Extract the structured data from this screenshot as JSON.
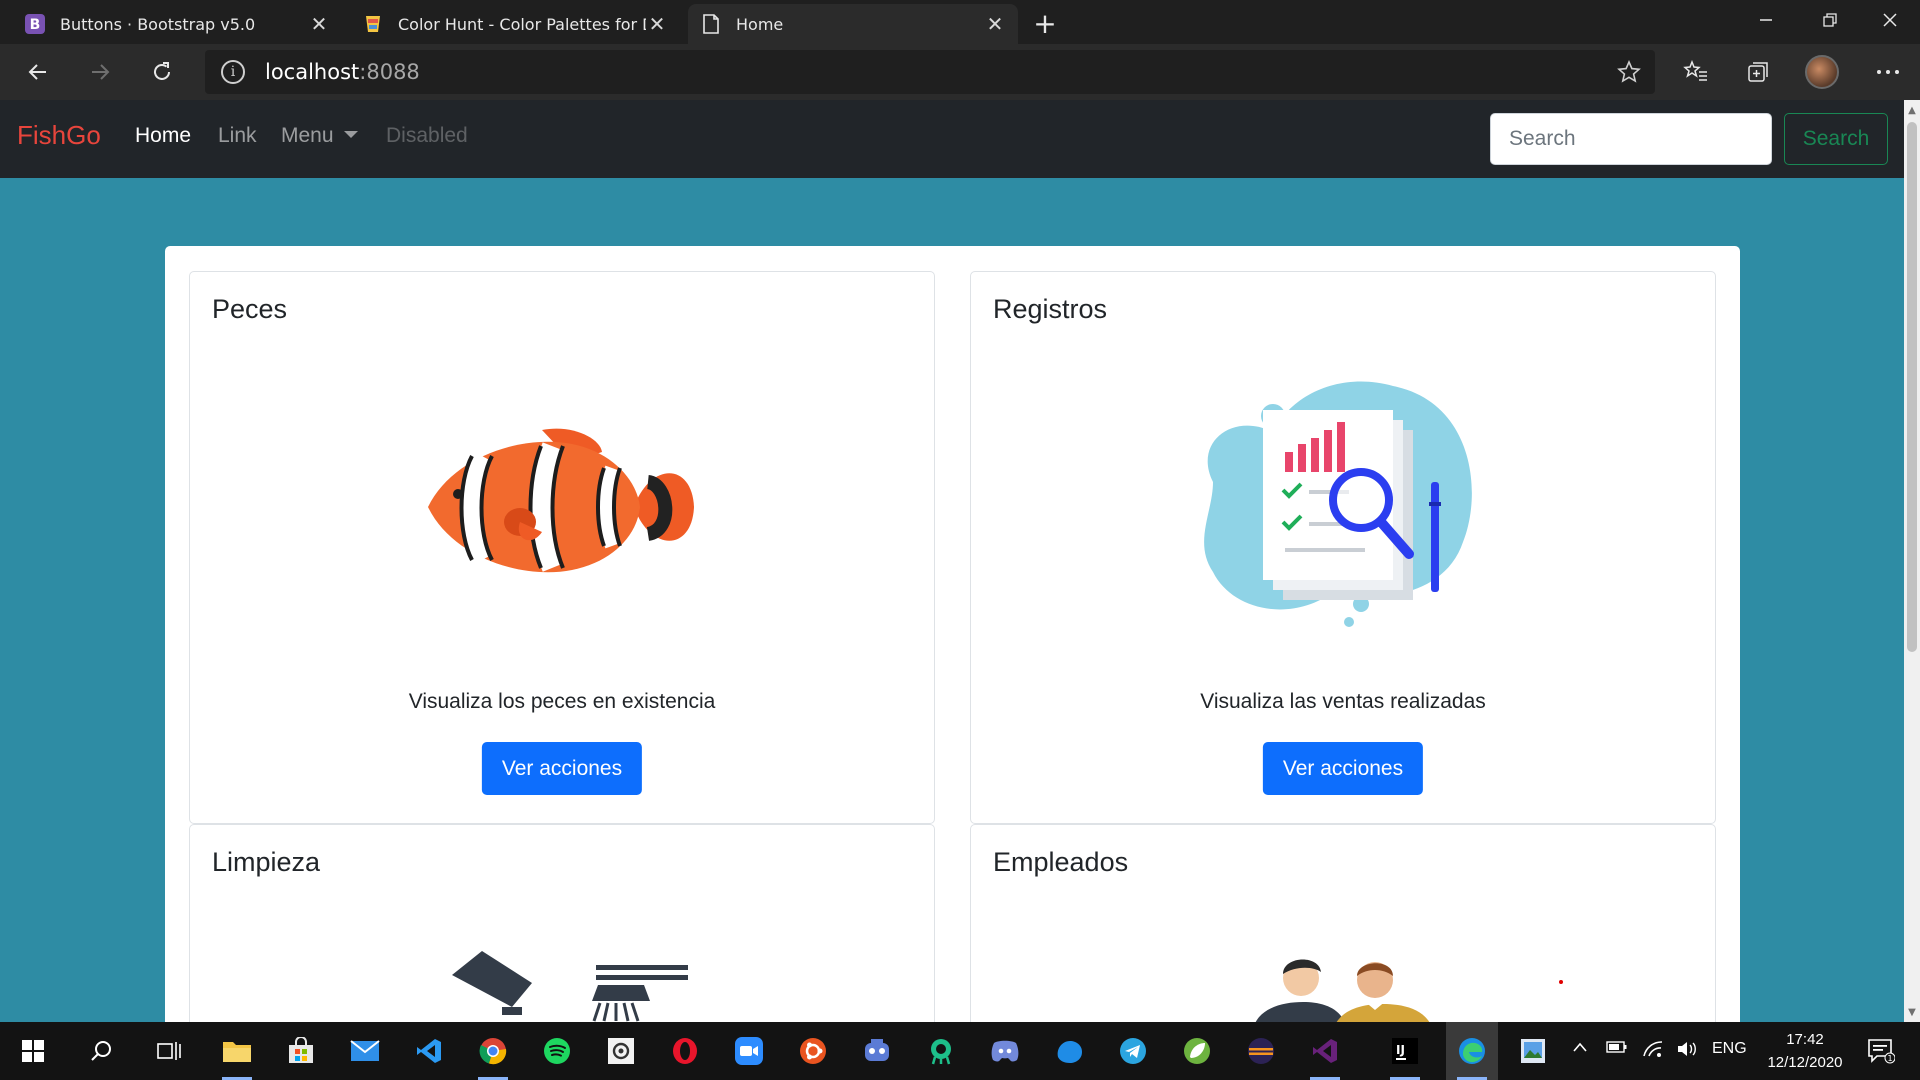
{
  "browser": {
    "tabs": [
      {
        "title": "Buttons · Bootstrap v5.0",
        "icon": "bootstrap-icon"
      },
      {
        "title": "Color Hunt - Color Palettes for D",
        "icon": "color-hunt-icon"
      },
      {
        "title": "Home",
        "icon": "page-icon",
        "active": true
      }
    ],
    "url_host": "localhost",
    "url_port": ":8088"
  },
  "navbar": {
    "brand": "FishGo",
    "links": [
      "Home",
      "Link",
      "Menu",
      "Disabled"
    ],
    "search_placeholder": "Search",
    "search_button": "Search"
  },
  "cards": [
    {
      "title": "Peces",
      "text": "Visualiza los peces en existencia",
      "button": "Ver acciones",
      "image": "clownfish"
    },
    {
      "title": "Registros",
      "text": "Visualiza las ventas realizadas",
      "button": "Ver acciones",
      "image": "report-magnifier"
    },
    {
      "title": "Limpieza",
      "image": "cleaning"
    },
    {
      "title": "Empleados",
      "image": "employees"
    }
  ],
  "taskbar": {
    "apps": [
      "file-explorer",
      "store",
      "mail",
      "vscode",
      "chrome",
      "spotify",
      "app-settings",
      "opera",
      "zoom",
      "ubuntu",
      "gamepad",
      "gitkraken",
      "discord",
      "photos",
      "telegram",
      "spring",
      "eclipse",
      "visual-studio",
      "intellij",
      "edge",
      "paint"
    ],
    "lang": "ENG",
    "time": "17:42",
    "date": "12/12/2020",
    "notification_count": "1"
  },
  "colors": {
    "page_bg": "#2e8ca4",
    "navbar_bg": "#212529",
    "brand": "#e8453c",
    "primary": "#0d6efd",
    "success": "#198754"
  }
}
